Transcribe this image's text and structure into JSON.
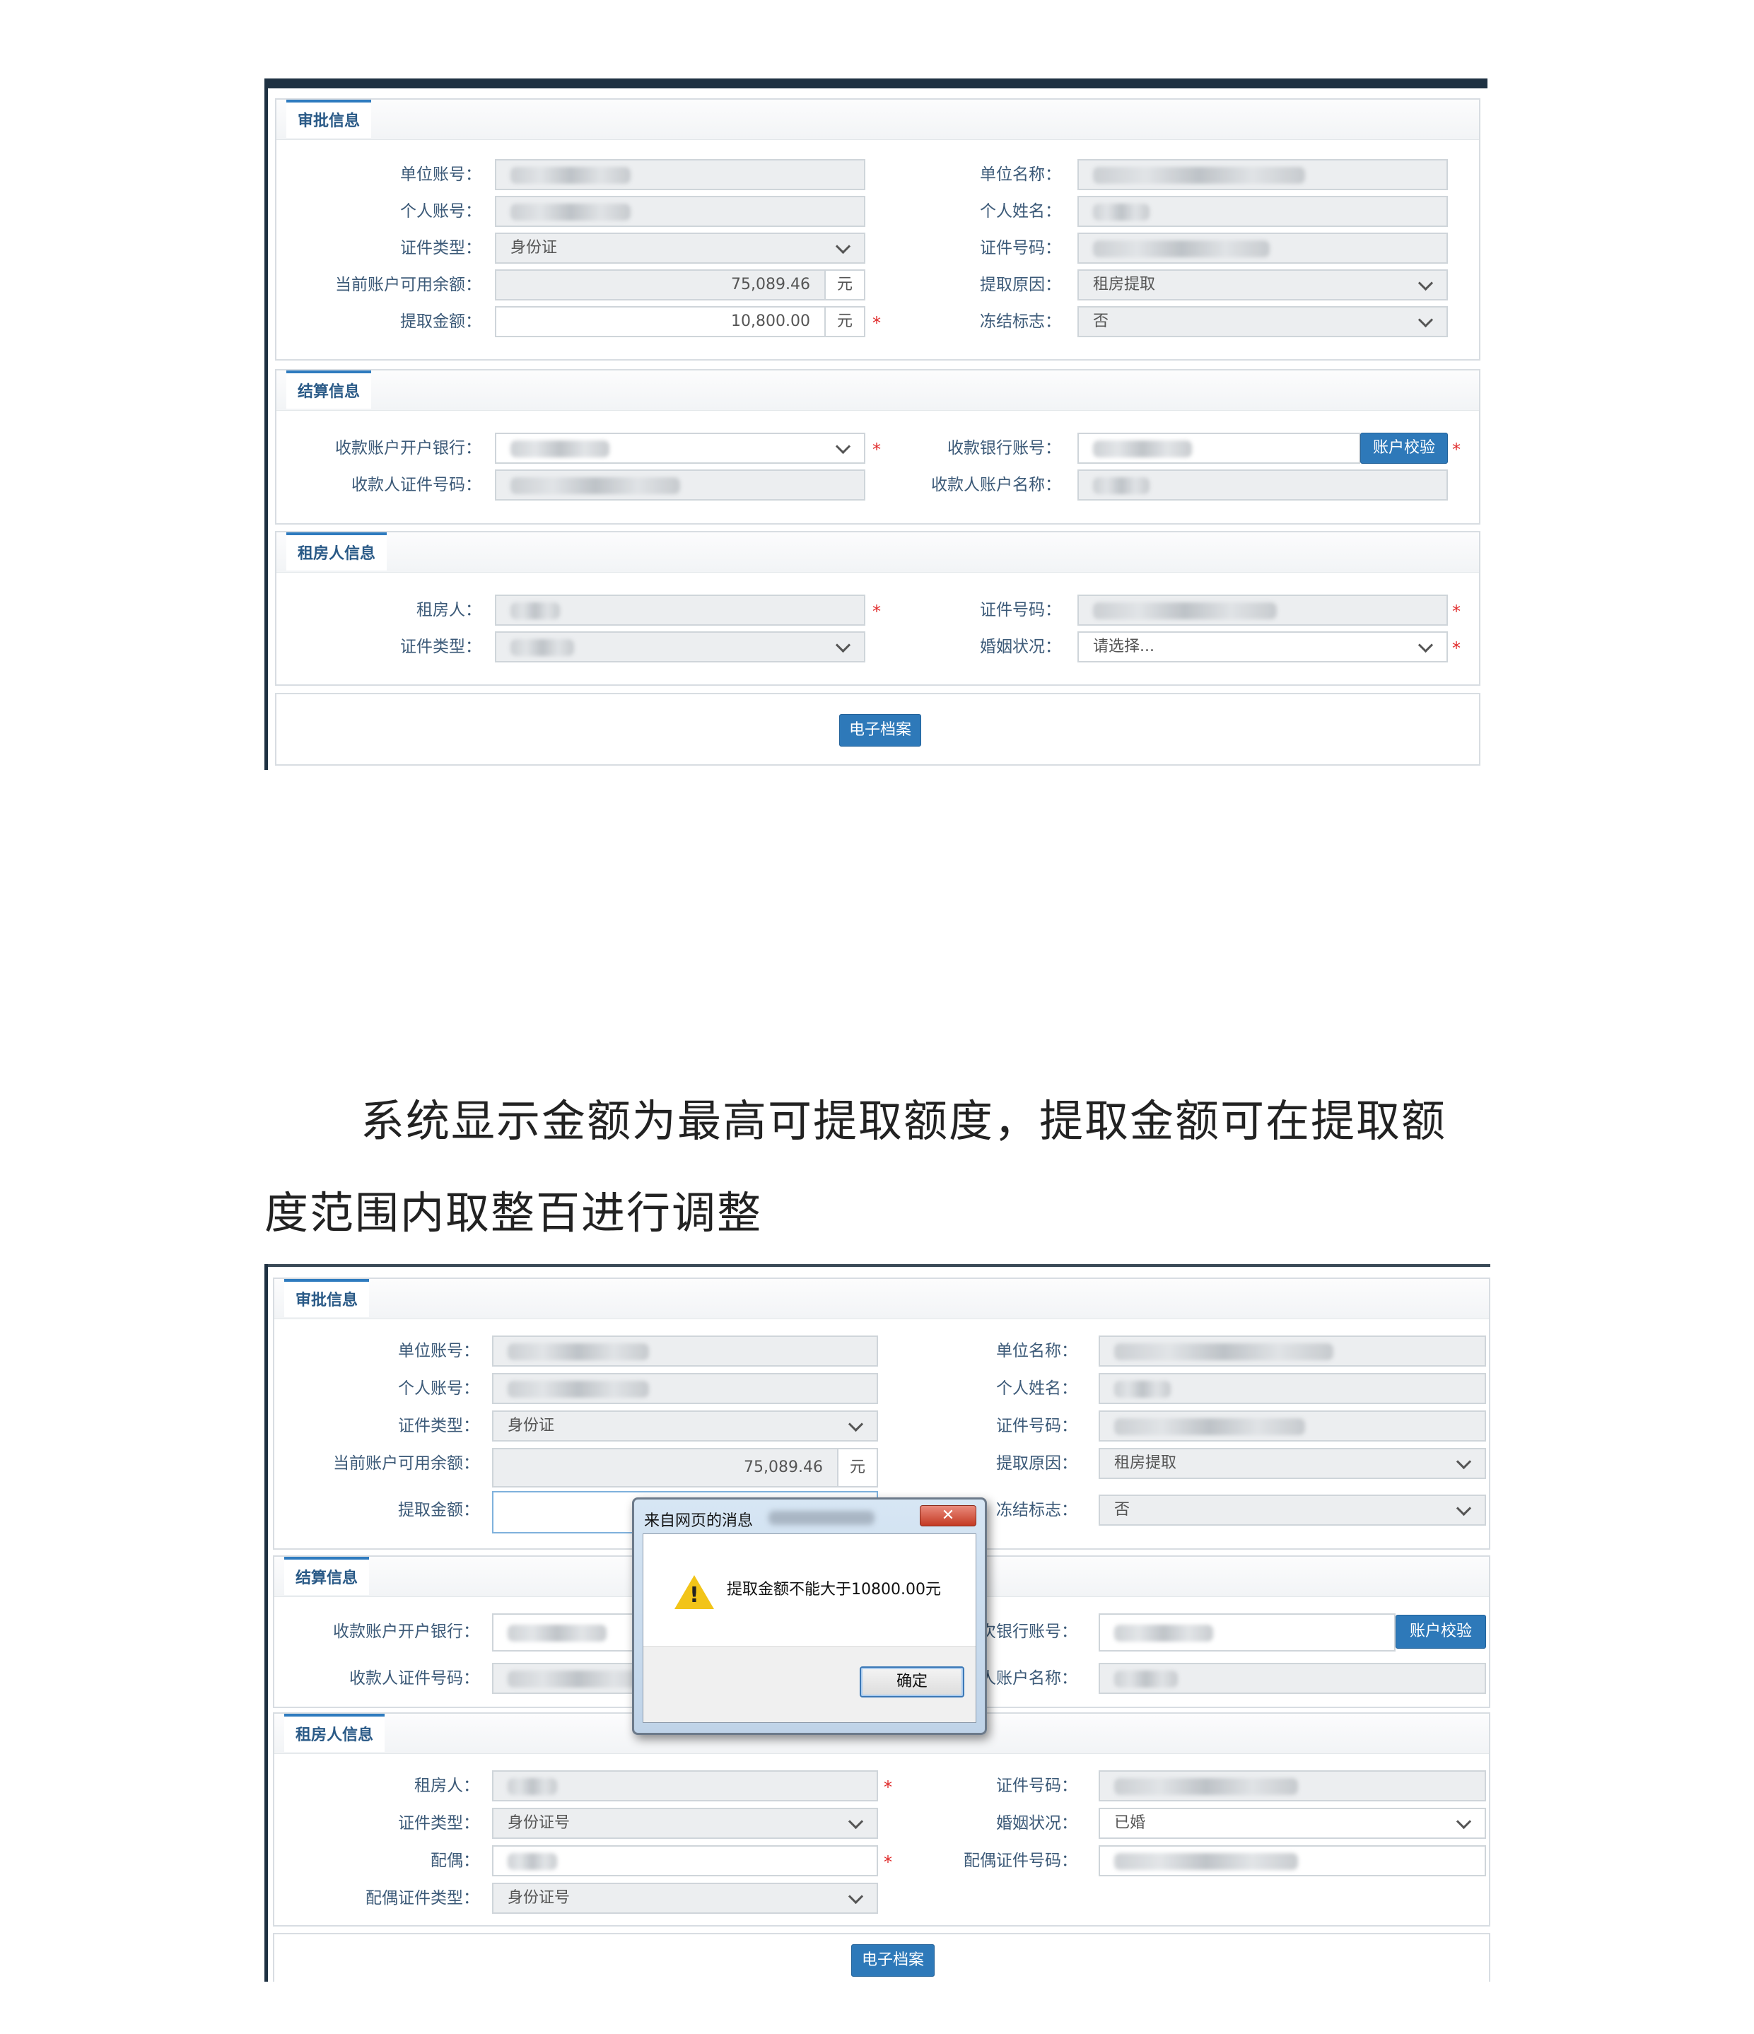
{
  "shot1": {
    "approval": {
      "title": "审批信息",
      "unit_account_label": "单位账号：",
      "unit_name_label": "单位名称：",
      "personal_account_label": "个人账号：",
      "personal_name_label": "个人姓名：",
      "id_type_label": "证件类型：",
      "id_type_value": "身份证",
      "id_number_label": "证件号码：",
      "balance_label": "当前账户可用余额：",
      "balance_value": "75,089.46",
      "balance_unit": "元",
      "reason_label": "提取原因：",
      "reason_value": "租房提取",
      "amount_label": "提取金额：",
      "amount_value": "10,800.00",
      "amount_unit": "元",
      "freeze_label": "冻结标志：",
      "freeze_value": "否"
    },
    "settlement": {
      "title": "结算信息",
      "bank_label": "收款账户开户银行：",
      "bank_account_label": "收款银行账号：",
      "verify_button": "账户校验",
      "payee_id_label": "收款人证件号码：",
      "payee_name_label": "收款人账户名称："
    },
    "tenant": {
      "title": "租房人信息",
      "tenant_label": "租房人：",
      "id_number_label": "证件号码：",
      "id_type_label": "证件类型：",
      "marital_label": "婚姻状况：",
      "marital_value": "请选择..."
    },
    "archive_button": "电子档案"
  },
  "paragraph": {
    "line1": "系统显示金额为最高可提取额度，提取金额可在提取额",
    "line2": "度范围内取整百进行调整"
  },
  "shot2": {
    "approval": {
      "title": "审批信息",
      "unit_account_label": "单位账号：",
      "unit_name_label": "单位名称：",
      "personal_account_label": "个人账号：",
      "personal_name_label": "个人姓名：",
      "id_type_label": "证件类型：",
      "id_type_value": "身份证",
      "id_number_label": "证件号码：",
      "balance_label": "当前账户可用余额：",
      "balance_value": "75,089.46",
      "balance_unit": "元",
      "reason_label": "提取原因：",
      "reason_value": "租房提取",
      "amount_label": "提取金额：",
      "freeze_label": "冻结标志：",
      "freeze_value": "否"
    },
    "settlement": {
      "title": "结算信息",
      "bank_label": "收款账户开户银行：",
      "bank_account_label": "次银行账号：",
      "verify_button": "账户校验",
      "payee_id_label": "收款人证件号码：",
      "payee_name_label": "人账户名称："
    },
    "tenant": {
      "title": "租房人信息",
      "tenant_label": "租房人：",
      "id_number_label": "证件号码：",
      "id_type_label": "证件类型：",
      "id_type_value": "身份证号",
      "marital_label": "婚姻状况：",
      "marital_value": "已婚",
      "spouse_label": "配偶：",
      "spouse_id_label": "配偶证件号码：",
      "spouse_id_type_label": "配偶证件类型：",
      "spouse_id_type_value": "身份证号"
    },
    "archive_button": "电子档案",
    "dialog": {
      "title": "来自网页的消息",
      "close": "✕",
      "message": "提取金额不能大于10800.00元",
      "ok_button": "确定",
      "warning_icon": "warning-icon"
    }
  },
  "colors": {
    "accent": "#2e79b9",
    "required": "#e02b2b",
    "panel_title": "#2a5a87",
    "warning": "#f2c418"
  }
}
